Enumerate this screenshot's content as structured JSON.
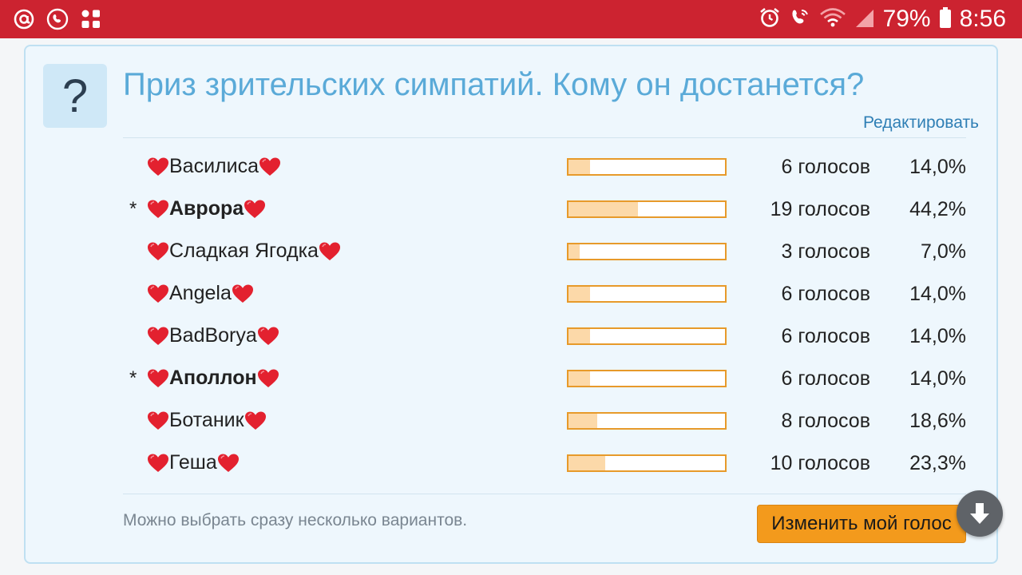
{
  "status_bar": {
    "battery": "79%",
    "time": "8:56"
  },
  "poll": {
    "badge": "?",
    "title": "Приз зрительских симпатий. Кому он достанется?",
    "edit_label": "Редактировать",
    "options": [
      {
        "name": "Василиса",
        "voted": false,
        "votes": "6 голосов",
        "percent": "14,0%",
        "share": 0.14
      },
      {
        "name": "Аврора",
        "voted": true,
        "votes": "19 голосов",
        "percent": "44,2%",
        "share": 0.442
      },
      {
        "name": "Сладкая Ягодка",
        "voted": false,
        "votes": "3 голосов",
        "percent": "7,0%",
        "share": 0.07
      },
      {
        "name": "Angela",
        "voted": false,
        "votes": "6 голосов",
        "percent": "14,0%",
        "share": 0.14
      },
      {
        "name": "BadBorya",
        "voted": false,
        "votes": "6 голосов",
        "percent": "14,0%",
        "share": 0.14
      },
      {
        "name": "Аполлон",
        "voted": true,
        "votes": "6 голосов",
        "percent": "14,0%",
        "share": 0.14
      },
      {
        "name": "Ботаник",
        "voted": false,
        "votes": "8 голосов",
        "percent": "18,6%",
        "share": 0.186
      },
      {
        "name": "Геша",
        "voted": false,
        "votes": "10 голосов",
        "percent": "23,3%",
        "share": 0.233
      }
    ],
    "vote_marker": "*",
    "hint": "Можно выбрать сразу несколько вариантов.",
    "change_vote_label": "Изменить мой голос"
  },
  "colors": {
    "status_bar": "#cc2330",
    "title": "#5aaad8",
    "bar_border": "#e79a2a",
    "bar_fill": "#fcd9a9",
    "button": "#f39a1c"
  },
  "icons": {
    "status_left": [
      "at-sign-icon",
      "wifi-calling-icon",
      "app-grid-icon"
    ],
    "status_right": [
      "alarm-icon",
      "wifi-call-icon",
      "wifi-icon",
      "signal-icon",
      "battery-icon"
    ],
    "option_decoration": "heart-icon",
    "scroll": "arrow-down-icon"
  }
}
